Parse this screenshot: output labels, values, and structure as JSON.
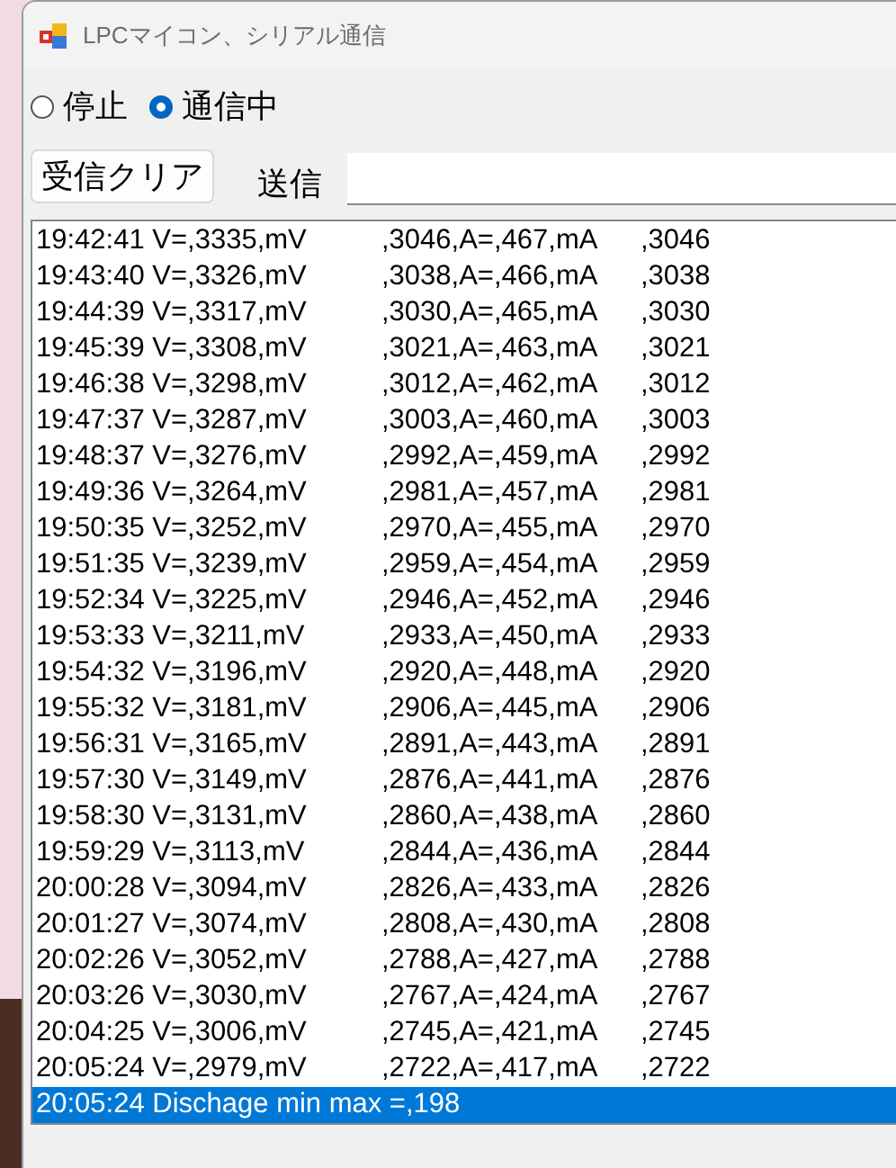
{
  "window": {
    "title": "LPCマイコン、シリアル通信"
  },
  "mode_radios": [
    {
      "label": "停止",
      "selected": false
    },
    {
      "label": "通信中",
      "selected": true
    }
  ],
  "clear_button": {
    "label": "受信クリア"
  },
  "send": {
    "label": "送信"
  },
  "log": [
    {
      "text": "19:42:41 V=,3335,mV\t,3046,A=,467,mA\t,3046",
      "selected": false
    },
    {
      "text": "19:43:40 V=,3326,mV\t,3038,A=,466,mA\t,3038",
      "selected": false
    },
    {
      "text": "19:44:39 V=,3317,mV\t,3030,A=,465,mA\t,3030",
      "selected": false
    },
    {
      "text": "19:45:39 V=,3308,mV\t,3021,A=,463,mA\t,3021",
      "selected": false
    },
    {
      "text": "19:46:38 V=,3298,mV\t,3012,A=,462,mA\t,3012",
      "selected": false
    },
    {
      "text": "19:47:37 V=,3287,mV\t,3003,A=,460,mA\t,3003",
      "selected": false
    },
    {
      "text": "19:48:37 V=,3276,mV\t,2992,A=,459,mA\t,2992",
      "selected": false
    },
    {
      "text": "19:49:36 V=,3264,mV\t,2981,A=,457,mA\t,2981",
      "selected": false
    },
    {
      "text": "19:50:35 V=,3252,mV\t,2970,A=,455,mA\t,2970",
      "selected": false
    },
    {
      "text": "19:51:35 V=,3239,mV\t,2959,A=,454,mA\t,2959",
      "selected": false
    },
    {
      "text": "19:52:34 V=,3225,mV\t,2946,A=,452,mA\t,2946",
      "selected": false
    },
    {
      "text": "19:53:33 V=,3211,mV\t,2933,A=,450,mA\t,2933",
      "selected": false
    },
    {
      "text": "19:54:32 V=,3196,mV\t,2920,A=,448,mA\t,2920",
      "selected": false
    },
    {
      "text": "19:55:32 V=,3181,mV\t,2906,A=,445,mA\t,2906",
      "selected": false
    },
    {
      "text": "19:56:31 V=,3165,mV\t,2891,A=,443,mA\t,2891",
      "selected": false
    },
    {
      "text": "19:57:30 V=,3149,mV\t,2876,A=,441,mA\t,2876",
      "selected": false
    },
    {
      "text": "19:58:30 V=,3131,mV\t,2860,A=,438,mA\t,2860",
      "selected": false
    },
    {
      "text": "19:59:29 V=,3113,mV\t,2844,A=,436,mA\t,2844",
      "selected": false
    },
    {
      "text": "20:00:28 V=,3094,mV\t,2826,A=,433,mA\t,2826",
      "selected": false
    },
    {
      "text": "20:01:27 V=,3074,mV\t,2808,A=,430,mA\t,2808",
      "selected": false
    },
    {
      "text": "20:02:26 V=,3052,mV\t,2788,A=,427,mA\t,2788",
      "selected": false
    },
    {
      "text": "20:03:26 V=,3030,mV\t,2767,A=,424,mA\t,2767",
      "selected": false
    },
    {
      "text": "20:04:25 V=,3006,mV\t,2745,A=,421,mA\t,2745",
      "selected": false
    },
    {
      "text": "20:05:24 V=,2979,mV\t,2722,A=,417,mA\t,2722",
      "selected": false
    },
    {
      "text": "20:05:24 Dischage min max =,198",
      "selected": true
    }
  ]
}
